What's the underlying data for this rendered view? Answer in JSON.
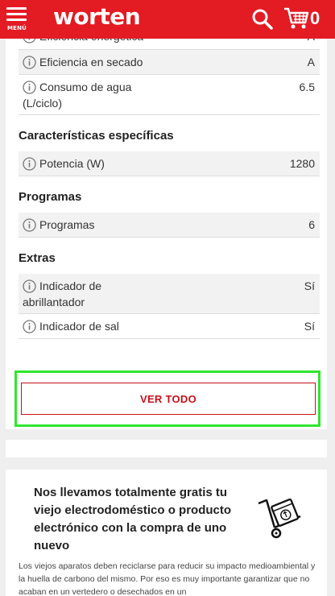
{
  "header": {
    "menu_label": "MENÚ",
    "logo_text": "worten",
    "cart_count": "0",
    "brand_color": "#e31b23"
  },
  "specs": {
    "partial_row_label": "Eficiencia energética",
    "partial_row_value": "A",
    "rows_top": [
      {
        "label": "Eficiencia en secado",
        "value": "A"
      },
      {
        "label": "Consumo de agua (L/ciclo)",
        "label_line1": "Consumo de agua",
        "label_line2": "(L/ciclo)",
        "value": "6.5"
      }
    ],
    "sections": [
      {
        "title": "Características específicas",
        "rows": [
          {
            "label": "Potencia (W)",
            "value": "1280"
          }
        ]
      },
      {
        "title": "Programas",
        "rows": [
          {
            "label": "Programas",
            "value": "6"
          }
        ]
      },
      {
        "title": "Extras",
        "rows": [
          {
            "label_line1": "Indicador de",
            "label_line2": "abrillantador",
            "value": "Sí"
          },
          {
            "label": "Indicador de sal",
            "value": "Sí"
          }
        ]
      }
    ],
    "ver_todo_label": "VER TODO"
  },
  "promo": {
    "title": "Nos llevamos totalmente gratis tu viejo electrodoméstico o producto electrónico con la compra de uno nuevo",
    "text": "Los viejos aparatos deben reciclarse para reducir su impacto medioambiental y la huella de carbono del mismo. Por eso es muy importante garantizar que no acaban en un vertedero o desechados en un",
    "icon": "recycle-cart-icon"
  }
}
